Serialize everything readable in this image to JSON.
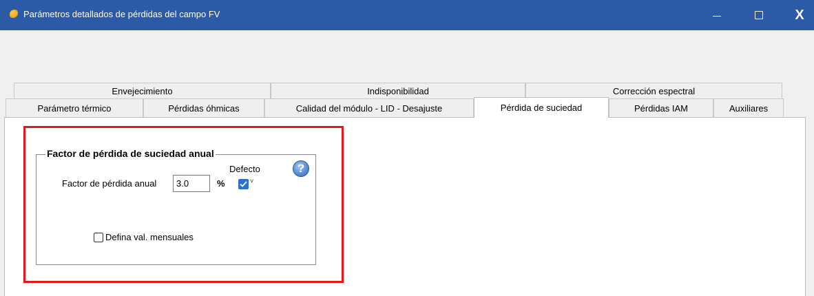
{
  "window": {
    "title": "Parámetros detallados de pérdidas del campo FV",
    "close_label": "X"
  },
  "tabs": {
    "row1": [
      "Envejecimiento",
      "Indisponibilidad",
      "Corrección espectral"
    ],
    "row2": [
      "Parámetro térmico",
      "Pérdidas óhmicas",
      "Calidad del módulo - LID - Desajuste",
      "Pérdida de suciedad",
      "Pérdidas IAM",
      "Auxiliares"
    ],
    "active": "Pérdida de suciedad"
  },
  "group": {
    "title": "Factor de pérdida de suciedad anual",
    "default_label": "Defecto",
    "help_symbol": "?",
    "factor_label": "Factor de pérdida anual",
    "factor_value": "3.0",
    "unit": "%",
    "default_checked": true,
    "monthly_checked": false,
    "monthly_label": "Defina val. mensuales"
  },
  "colors": {
    "titlebar": "#2c5aa6",
    "highlight": "#e4161b",
    "checkbox_accent": "#2f6fd0"
  },
  "icons": [
    "app-icon",
    "minimize-icon",
    "maximize-icon",
    "close-icon",
    "help-icon",
    "check-icon",
    "chevron-down-icon"
  ]
}
